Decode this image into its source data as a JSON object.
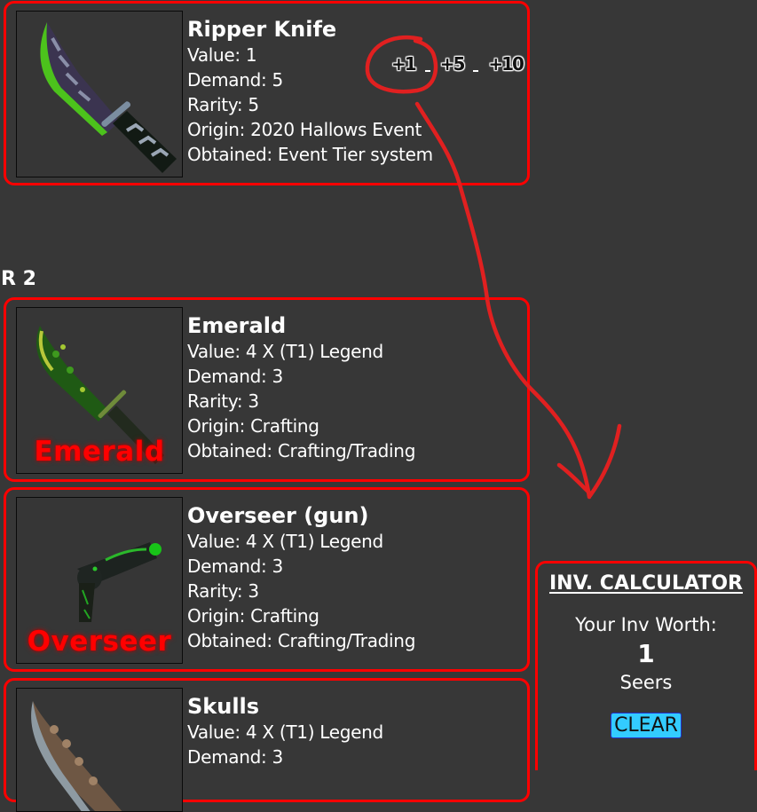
{
  "section_label": "R 2",
  "items": [
    {
      "name": "Ripper Knife",
      "value": "Value: 1",
      "demand": "Demand: 5",
      "rarity": "Rarity: 5",
      "origin": "Origin: 2020 Hallows Event",
      "obtained": "Obtained: Event Tier system",
      "image_label": "",
      "add_buttons": [
        "+1",
        "+5",
        "+10"
      ]
    },
    {
      "name": "Emerald",
      "value": "Value: 4 X (T1) Legend",
      "demand": "Demand: 3",
      "rarity": "Rarity: 3",
      "origin": "Origin: Crafting",
      "obtained": "Obtained: Crafting/Trading",
      "image_label": "Emerald"
    },
    {
      "name": "Overseer (gun)",
      "value": "Value: 4 X (T1) Legend",
      "demand": "Demand: 3",
      "rarity": "Rarity: 3",
      "origin": "Origin: Crafting",
      "obtained": "Obtained: Crafting/Trading",
      "image_label": "Overseer"
    },
    {
      "name": "Skulls",
      "value": "Value: 4 X (T1) Legend",
      "demand": "Demand: 3"
    }
  ],
  "calculator": {
    "title": "INV. CALCULATOR",
    "worth_label": "Your Inv Worth:",
    "worth_value": "1",
    "unit": "Seers",
    "clear_label": "CLEAR"
  },
  "colors": {
    "background": "#373737",
    "card_border": "#ff0000",
    "clear_button": "#33ccff",
    "annotation": "#e02020"
  }
}
